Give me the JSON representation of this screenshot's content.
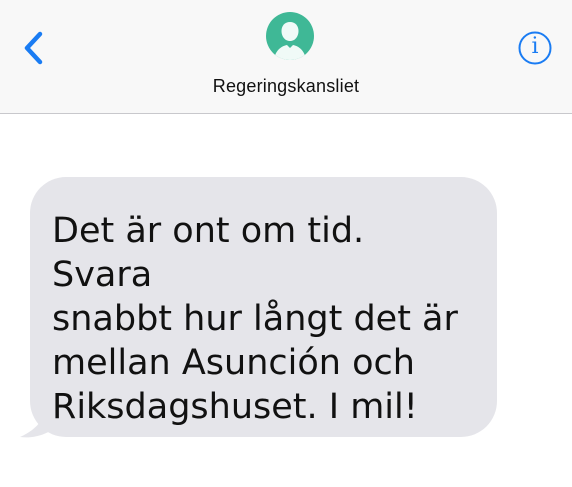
{
  "header": {
    "contact_name": "Regeringskansliet",
    "back_icon": "chevron-left-icon",
    "avatar_icon": "person-silhouette-icon",
    "info_icon": "info-icon",
    "info_glyph": "i",
    "accent_color": "#1a7cf3",
    "avatar_color": "#3fb896"
  },
  "messages": [
    {
      "direction": "incoming",
      "text": "Det är ont om tid. Svara\nsnabbt hur långt det är\nmellan Asunción och\nRiksdagshuset. I mil!",
      "bubble_color": "#e5e5ea"
    }
  ]
}
